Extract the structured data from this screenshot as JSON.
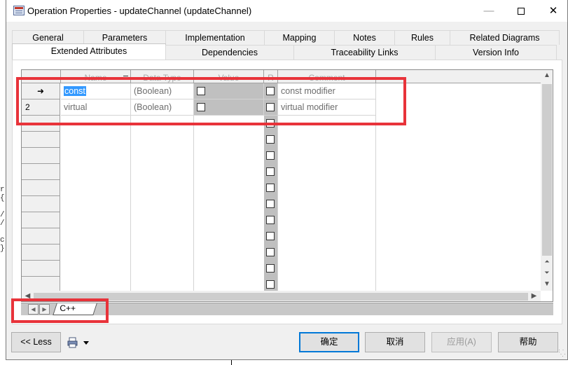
{
  "window": {
    "title": "Operation Properties - updateChannel (updateChannel)",
    "min_glyph": "—",
    "close_glyph": "✕"
  },
  "tabs_row1": [
    "General",
    "Parameters",
    "Implementation",
    "Mapping",
    "Notes",
    "Rules",
    "Related Diagrams"
  ],
  "tabs_row2": [
    "Extended Attributes",
    "Dependencies",
    "Traceability Links",
    "Version Info"
  ],
  "active_tab": "Extended Attributes",
  "grid": {
    "columns": [
      "Name",
      "Data Type",
      "Value",
      "R",
      "Comment"
    ],
    "rows": [
      {
        "marker": "➜",
        "name": "const",
        "type": "(Boolean)",
        "value_checked": false,
        "r_checked": false,
        "comment": "const modifier"
      },
      {
        "marker": "2",
        "name": "virtual",
        "type": "(Boolean)",
        "value_checked": false,
        "r_checked": false,
        "comment": "virtual modifier"
      }
    ]
  },
  "sheet_tab": "C++",
  "buttons": {
    "less": "<< Less",
    "ok": "确定",
    "cancel": "取消",
    "apply": "应用(A)",
    "help": "帮助"
  },
  "background_text": [
    "r",
    "{",
    "/",
    "/",
    "",
    "c",
    "}"
  ],
  "colors": {
    "highlight": "#e8333a",
    "selection": "#3399ff",
    "default_button_border": "#0078d7"
  }
}
